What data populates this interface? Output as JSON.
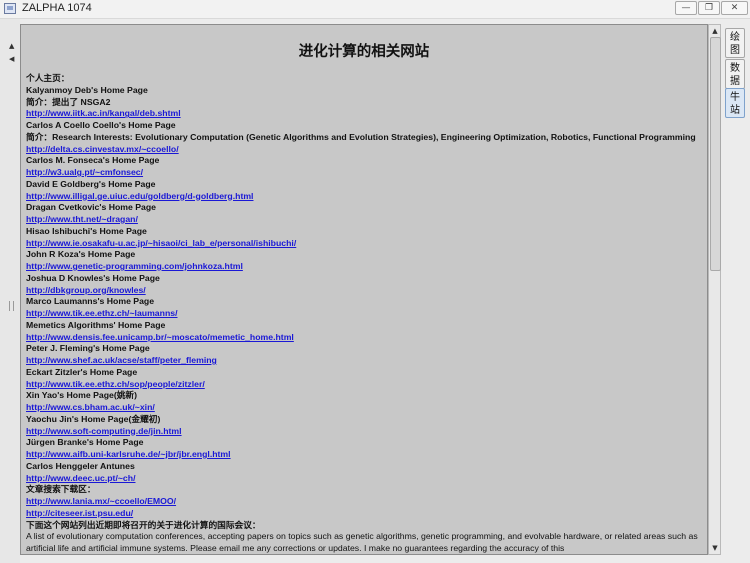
{
  "window": {
    "title": "ZALPHA 1074",
    "min_glyph": "—",
    "max_glyph": "❐",
    "close_glyph": "✕"
  },
  "page": {
    "title": "进化计算的相关网站",
    "lines": [
      {
        "text": "个人主页：",
        "type": "label"
      },
      {
        "text": "Kalyanmoy Deb's Home Page",
        "type": "label"
      },
      {
        "text": "简介：提出了 NSGA2",
        "type": "label"
      },
      {
        "text": "http://www.iitk.ac.in/kangal/deb.shtml",
        "type": "link"
      },
      {
        "text": "Carlos A Coello Coello's Home Page",
        "type": "label"
      },
      {
        "text": "简介：Research Interests: Evolutionary Computation (Genetic Algorithms and Evolution Strategies), Engineering Optimization, Robotics, Functional Programming",
        "type": "label"
      },
      {
        "text": "http://delta.cs.cinvestav.mx/~ccoello/",
        "type": "link"
      },
      {
        "text": "Carlos M. Fonseca's Home Page",
        "type": "label"
      },
      {
        "text": "http://w3.ualg.pt/~cmfonsec/",
        "type": "link"
      },
      {
        "text": "David E Goldberg's Home Page",
        "type": "label"
      },
      {
        "text": "http://www.illigal.ge.uiuc.edu/goldberg/d-goldberg.html",
        "type": "link"
      },
      {
        "text": "Dragan Cvetkovic's Home Page",
        "type": "label"
      },
      {
        "text": "http://www.tht.net/~dragan/",
        "type": "link"
      },
      {
        "text": "Hisao Ishibuchi's Home Page",
        "type": "label"
      },
      {
        "text": "http://www.ie.osakafu-u.ac.jp/~hisaoi/ci_lab_e/personal/ishibuchi/",
        "type": "link"
      },
      {
        "text": "John R Koza's Home Page",
        "type": "label"
      },
      {
        "text": "http://www.genetic-programming.com/johnkoza.html",
        "type": "link"
      },
      {
        "text": "Joshua D Knowles's Home Page",
        "type": "label"
      },
      {
        "text": "http://dbkgroup.org/knowles/",
        "type": "link"
      },
      {
        "text": "Marco Laumanns's Home Page",
        "type": "label"
      },
      {
        "text": "http://www.tik.ee.ethz.ch/~laumanns/",
        "type": "link"
      },
      {
        "text": "Memetics Algorithms' Home Page",
        "type": "label"
      },
      {
        "text": "http://www.densis.fee.unicamp.br/~moscato/memetic_home.html",
        "type": "link"
      },
      {
        "text": "Peter J. Fleming's Home Page",
        "type": "label"
      },
      {
        "text": "http://www.shef.ac.uk/acse/staff/peter_fleming",
        "type": "link"
      },
      {
        "text": "Eckart Zitzler's Home Page",
        "type": "label"
      },
      {
        "text": "http://www.tik.ee.ethz.ch/sop/people/zitzler/",
        "type": "link"
      },
      {
        "text": "Xin Yao's Home Page(姚新)",
        "type": "label"
      },
      {
        "text": "http://www.cs.bham.ac.uk/~xin/",
        "type": "link"
      },
      {
        "text": "Yaochu Jin's Home Page(金耀初)",
        "type": "label"
      },
      {
        "text": "http://www.soft-computing.de/jin.html",
        "type": "link"
      },
      {
        "text": "Jürgen Branke's Home Page",
        "type": "label"
      },
      {
        "text": "http://www.aifb.uni-karlsruhe.de/~jbr/jbr.engl.html",
        "type": "link"
      },
      {
        "text": "Carlos Henggeler Antunes",
        "type": "label"
      },
      {
        "text": "http://www.deec.uc.pt/~ch/",
        "type": "link"
      },
      {
        "text": "文章搜索下载区：",
        "type": "label"
      },
      {
        "text": "http://www.lania.mx/~ccoello/EMOO/",
        "type": "link"
      },
      {
        "text": "http://citeseer.ist.psu.edu/",
        "type": "link"
      },
      {
        "text": "下面这个网站列出近期即将召开的关于进化计算的国际会议：",
        "type": "label"
      }
    ],
    "paragraph": "A list of evolutionary computation conferences, accepting papers on topics such as genetic algorithms, genetic programming, and evolvable hardware, or related areas such as artificial life and artificial immune systems. Please email me any corrections or updates. I make no guarantees regarding the accuracy of this"
  },
  "tabs": [
    {
      "label": "绘图",
      "active": false
    },
    {
      "label": "数据",
      "active": false
    },
    {
      "label": "牛站",
      "active": true
    }
  ],
  "icons": {
    "app": "app-window-icon",
    "scroll_up": "▲",
    "scroll_down": "▼",
    "gutter_up": "▲",
    "gutter_down": "◀"
  }
}
